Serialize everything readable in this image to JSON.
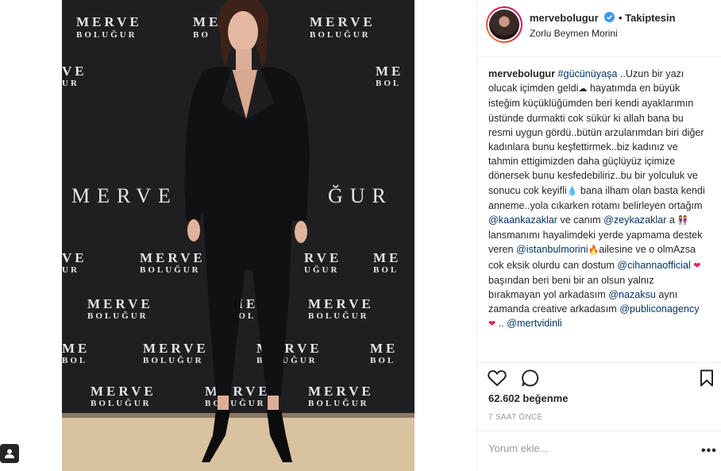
{
  "post": {
    "username": "mervebolugur",
    "follow_separator": "•",
    "follow_status": "Takiptesin",
    "location": "Zorlu Beymen Morini",
    "likes": "62.602 beğenme",
    "time": "7 SAAT ÖNCE",
    "comment_placeholder": "Yorum ekle...",
    "more_label": "•••"
  },
  "caption": {
    "author": "mervebolugur",
    "hashtag": "#gücünüyaşa",
    "text1": " ..Uzun bir yazı olucak içimden geldi",
    "text2": " hayatımda en büyük isteğim küçüklüğümden beri kendi ayaklarımın üstünde durmakti cok sükür ki allah bana bu resmi uygun gördü..bütün arzularımdan biri diğer kadınlara bunu keşfettirmek..biz kadınız ve tahmin ettigimizden daha güçlüyüz içimize dönersek bunu kesfedebiliriz..bu bir yolculuk ve sonucu cok keyifli",
    "text3": " bana ilham olan basta kendi annemе..yola cıkarken rotamı belirleyen ortağım ",
    "mention1": "@kaankazaklar",
    "text4": " ve canım ",
    "mention2": "@zeykazaklar",
    "text5": " a ",
    "text6": " lansmanımı hayalimdeki yerde yapmama destek veren ",
    "mention3": "@istanbulmorini",
    "text7": "ailesine ve o olmAzsa cok eksik olurdu can dostum ",
    "mention4": "@cihannaofficial",
    "text8": "  başından beri beni bir an olsun yalnız bırakmayan yol arkadasım ",
    "mention5": "@nazaksu",
    "text9": " aynı zamanda creative arkadasım ",
    "mention6": "@publiconagency",
    "text10": " .. ",
    "mention7": "@mertvidinli"
  },
  "photo": {
    "brand_word_1": "MERVE",
    "brand_word_2": "BOLUĞUR",
    "brand_big": "MERVE BOLUĞUR"
  },
  "colors": {
    "text": "#262626",
    "mention": "#003569",
    "muted": "#999999",
    "border": "#efefef",
    "verified": "#3897f0",
    "backdrop": "#1f1f22"
  },
  "icons": {
    "like": "heart-outline-icon",
    "comment": "speech-bubble-icon",
    "save": "bookmark-icon",
    "verified": "verified-badge-icon",
    "tag": "user-tag-icon"
  }
}
